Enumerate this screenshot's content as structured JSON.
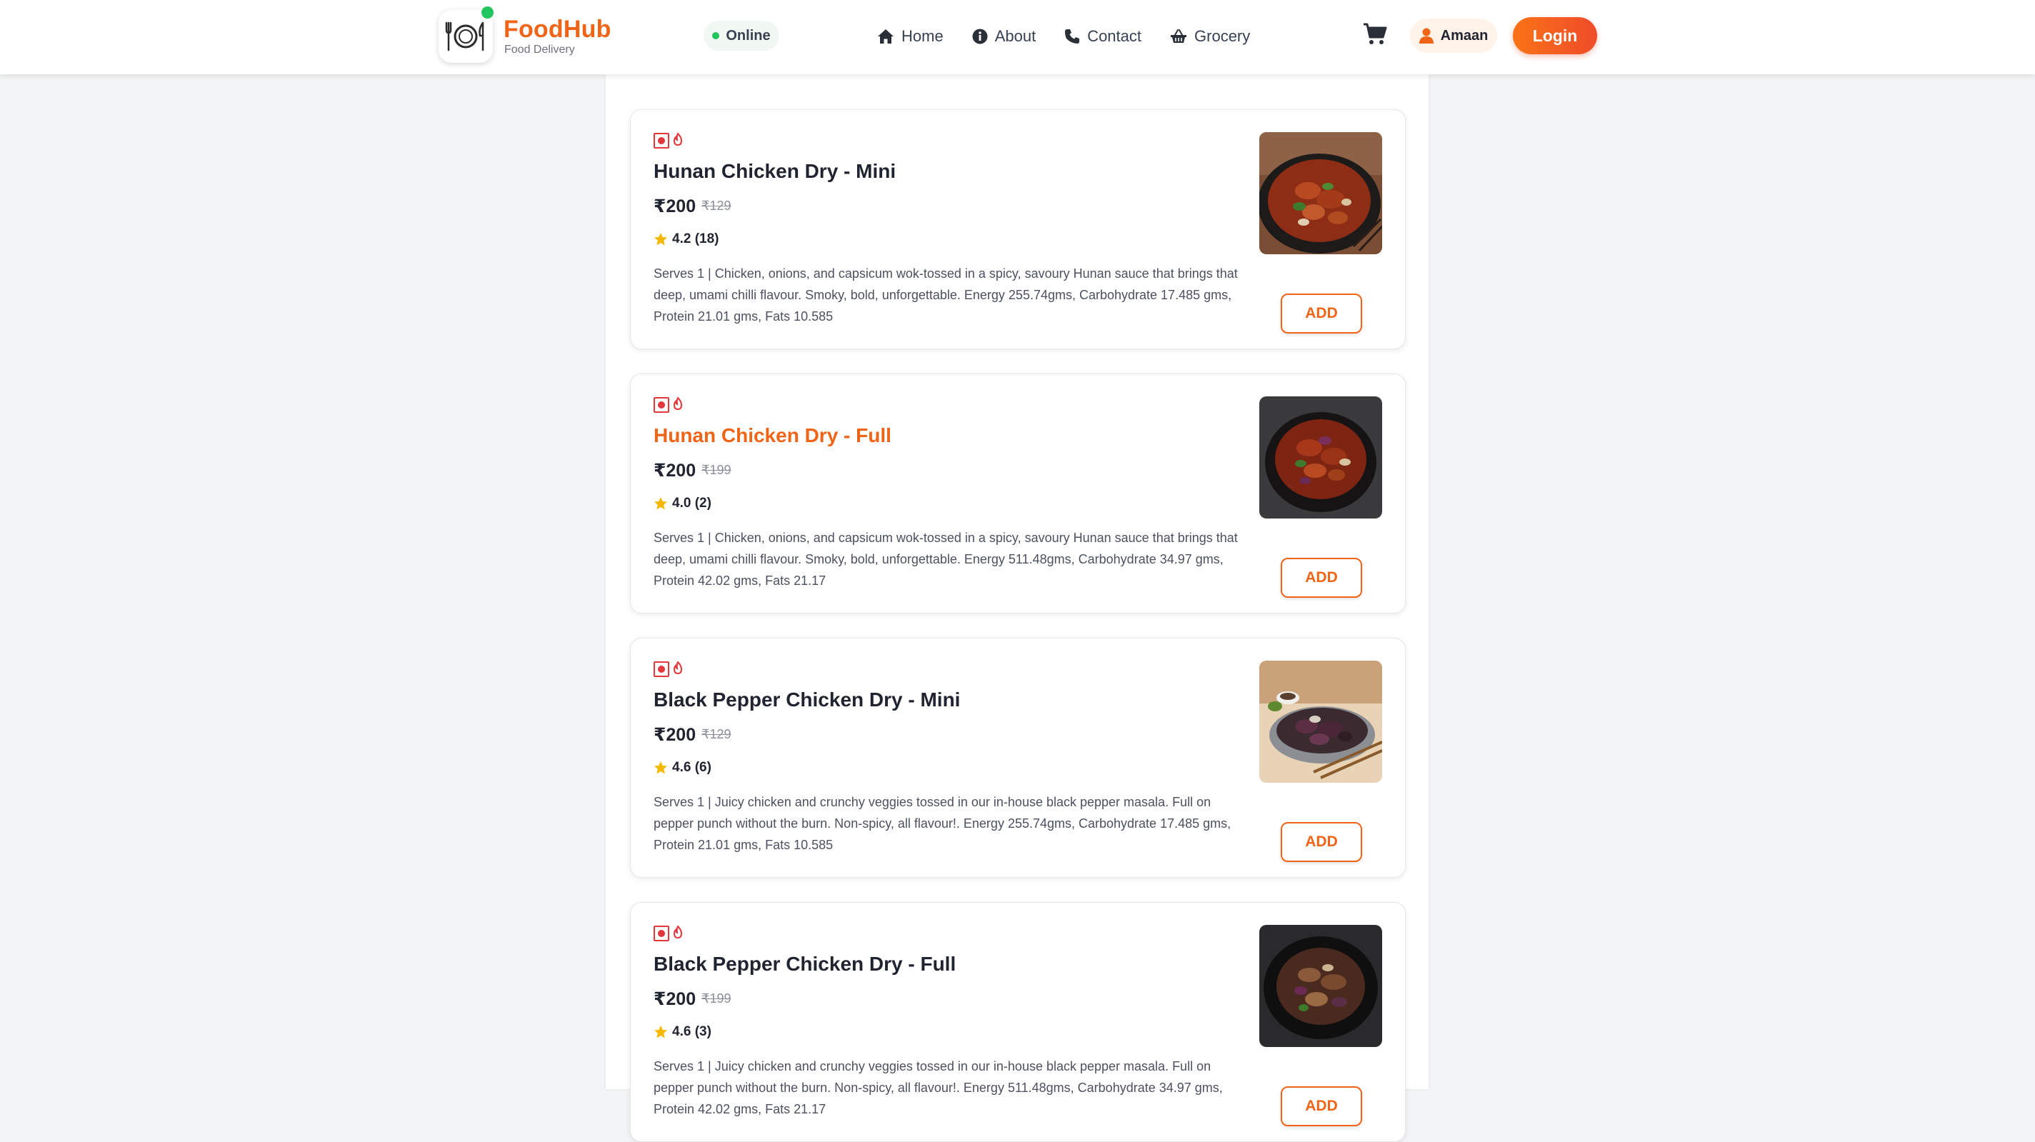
{
  "header": {
    "brand_name": "FoodHub",
    "brand_subtitle": "Food Delivery",
    "status": "Online",
    "nav": [
      {
        "label": "Home",
        "icon": "home-icon"
      },
      {
        "label": "About",
        "icon": "info-icon"
      },
      {
        "label": "Contact",
        "icon": "phone-icon"
      },
      {
        "label": "Grocery",
        "icon": "basket-icon"
      }
    ],
    "cart_icon": "cart-icon",
    "user_name": "Amaan",
    "login_label": "Login"
  },
  "colors": {
    "brand": "#f06418",
    "online": "#22c55e",
    "veg_mark": "#e5363d",
    "star": "#f5b800"
  },
  "items": [
    {
      "title": "Hunan Chicken Dry - Mini",
      "price": "₹200",
      "old_price": "₹129",
      "rating": "4.2 (18)",
      "description": "Serves 1 | Chicken, onions, and capsicum wok-tossed in a spicy, savoury Hunan sauce that brings that deep, umami chilli flavour. Smoky, bold, unforgettable. Energy 255.74gms, Carbohydrate 17.485 gms, Protein 21.01 gms, Fats 10.585",
      "add_label": "ADD"
    },
    {
      "title": "Hunan Chicken Dry - Full",
      "price": "₹200",
      "old_price": "₹199",
      "rating": "4.0 (2)",
      "description": "Serves 1 | Chicken, onions, and capsicum wok-tossed in a spicy, savoury Hunan sauce that brings that deep, umami chilli flavour. Smoky, bold, unforgettable. Energy 511.48gms, Carbohydrate 34.97 gms, Protein 42.02 gms, Fats 21.17",
      "add_label": "ADD"
    },
    {
      "title": "Black Pepper Chicken Dry - Mini",
      "price": "₹200",
      "old_price": "₹129",
      "rating": "4.6 (6)",
      "description": "Serves 1 | Juicy chicken and crunchy veggies tossed in our in-house black pepper masala. Full on pepper punch without the burn. Non-spicy, all flavour!. Energy 255.74gms, Carbohydrate 17.485 gms, Protein 21.01 gms, Fats 10.585",
      "add_label": "ADD"
    },
    {
      "title": "Black Pepper Chicken Dry - Full",
      "price": "₹200",
      "old_price": "₹199",
      "rating": "4.6 (3)",
      "description": "Serves 1 | Juicy chicken and crunchy veggies tossed in our in-house black pepper masala. Full on pepper punch without the burn. Non-spicy, all flavour!. Energy 511.48gms, Carbohydrate 34.97 gms, Protein 42.02 gms, Fats 21.17",
      "add_label": "ADD"
    }
  ]
}
